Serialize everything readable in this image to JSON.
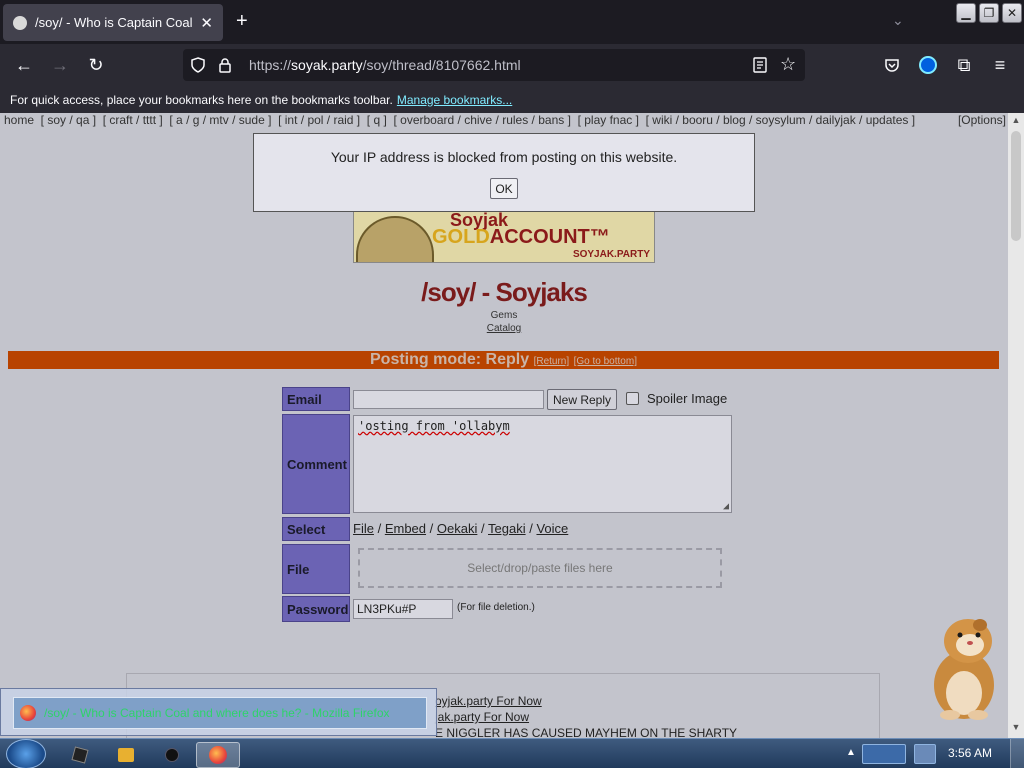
{
  "browser": {
    "tab_title": "/soy/ - Who is Captain Coal an",
    "tab_close": "✕",
    "new_tab": "+",
    "url_scheme": "https://",
    "url_host": "soyak.party",
    "url_path": "/soy/thread/8107662.html",
    "bookmarks_text": "For quick access, place your bookmarks here on the bookmarks toolbar.",
    "bookmarks_link": "Manage bookmarks..."
  },
  "boardlist": {
    "text": "home  [ soy / qa ]  [ craft / tttt ]  [ a / g / mtv / sude ]  [ int / pol / raid ]  [ q ]  [ overboard / chive / rules / bans ]  [ play fnac ]  [ wiki / booru / blog / soysylum / dailyjak / updates ]",
    "options": "[Options]"
  },
  "banner": {
    "line1": "Soyjak",
    "gold": "GOLD",
    "account": "ACCOUNT™",
    "site": "SOYJAK.PARTY"
  },
  "board": {
    "title": "/soy/ - Soyjaks",
    "link_gems": "Gems",
    "link_catalog": "Catalog"
  },
  "postmode": {
    "title": "Posting mode: Reply",
    "return": "[Return]",
    "bottom": "[Go to bottom]"
  },
  "form": {
    "email_label": "Email",
    "email_value": "",
    "new_reply": "New Reply",
    "spoiler_label": "Spoiler Image",
    "comment_label": "Comment",
    "comment_value": "'osting from 'ollabym",
    "select_label": "Select",
    "select_options": [
      "File",
      "Embed",
      "Oekaki",
      "Tegaki",
      "Voice"
    ],
    "select_sep": "/",
    "file_label": "File",
    "dropzone": "Select/drop/paste files here",
    "password_label": "Password",
    "password_value": "LN3PKu#P",
    "password_note": "(For file deletion.)"
  },
  "thread_links": [
    "oyjak.party For Now",
    "jak.party For Now",
    "E NIGGLER HAS CAUSED MAYHEM ON THE SHARTY"
  ],
  "alert": {
    "message": "Your IP address is blocked from posting on this website.",
    "ok": "OK"
  },
  "taskbar_preview": {
    "title": "/soy/ - Who is Captain Coal and where does he?  - Mozilla Firefox"
  },
  "taskbar": {
    "clock": "3:56 AM"
  }
}
